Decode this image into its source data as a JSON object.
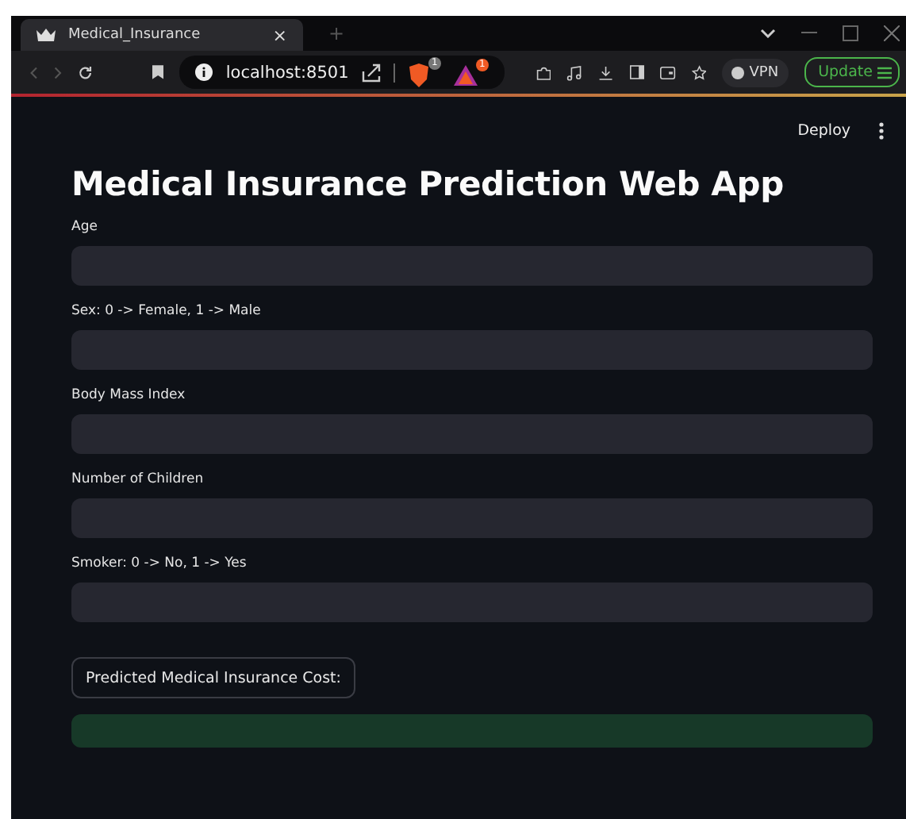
{
  "browser": {
    "tab_title": "Medical_Insurance",
    "tab_close": "×",
    "new_tab": "+",
    "address": "localhost:8501",
    "shield_badge": "1",
    "rewards_badge": "1",
    "vpn": "VPN",
    "update": "Update"
  },
  "header": {
    "deploy": "Deploy"
  },
  "title": "Medical Insurance Prediction Web App",
  "fields": [
    {
      "label": "Age"
    },
    {
      "label": "Sex: 0 -> Female, 1 -> Male"
    },
    {
      "label": "Body Mass Index"
    },
    {
      "label": "Number of Children"
    },
    {
      "label": "Smoker: 0 -> No, 1 -> Yes"
    }
  ],
  "predict_button": "Predicted Medical Insurance Cost:",
  "result": {
    "kind": "success"
  }
}
